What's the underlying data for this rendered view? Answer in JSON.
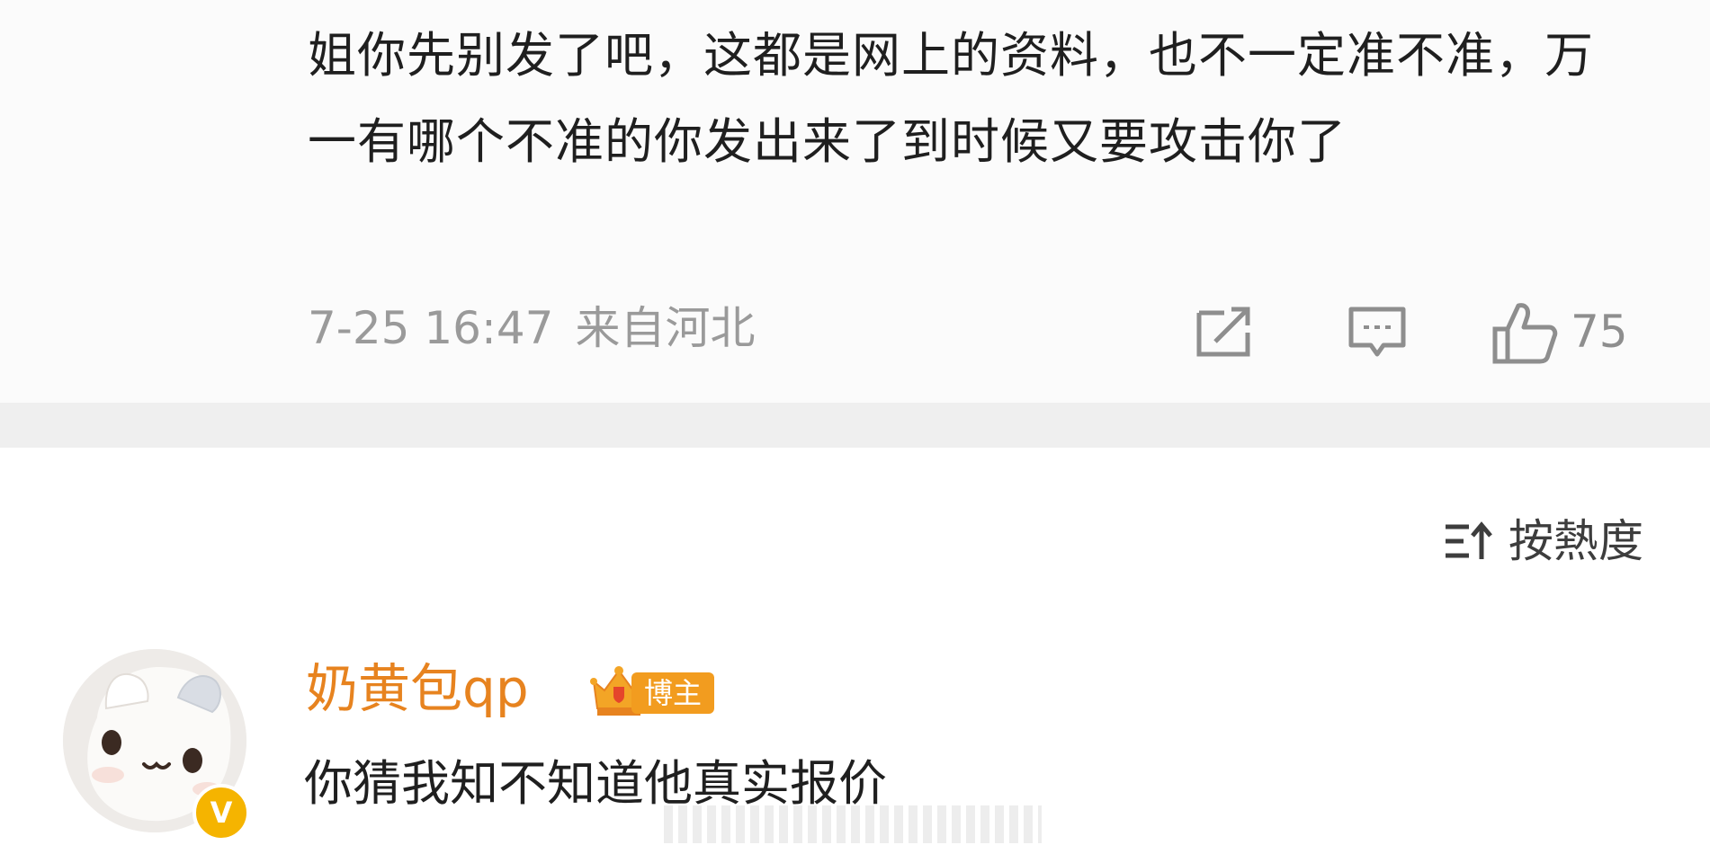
{
  "comment_above": {
    "text": "姐你先别发了吧，这都是网上的资料，也不一定准不准，万一有哪个不准的你发出来了到时候又要攻击你了",
    "timestamp": "7-25 16:47",
    "location": "来自河北",
    "like_count": "75",
    "icons": {
      "share": "share-icon",
      "reply": "comment-icon",
      "like": "thumbs-up-icon"
    }
  },
  "comments_section": {
    "sort_label": "按熱度",
    "sort_icon": "sort-icon"
  },
  "comment": {
    "username": "奶黄包qp",
    "badge_label": "博主",
    "verified_mark": "V",
    "text": "你猜我知不知道他真实报价"
  },
  "colors": {
    "username": "#e7831f",
    "badge": "#f29c1f",
    "verified": "#f5b400",
    "meta_gray": "#9a9a9a",
    "separator": "#efefef"
  }
}
